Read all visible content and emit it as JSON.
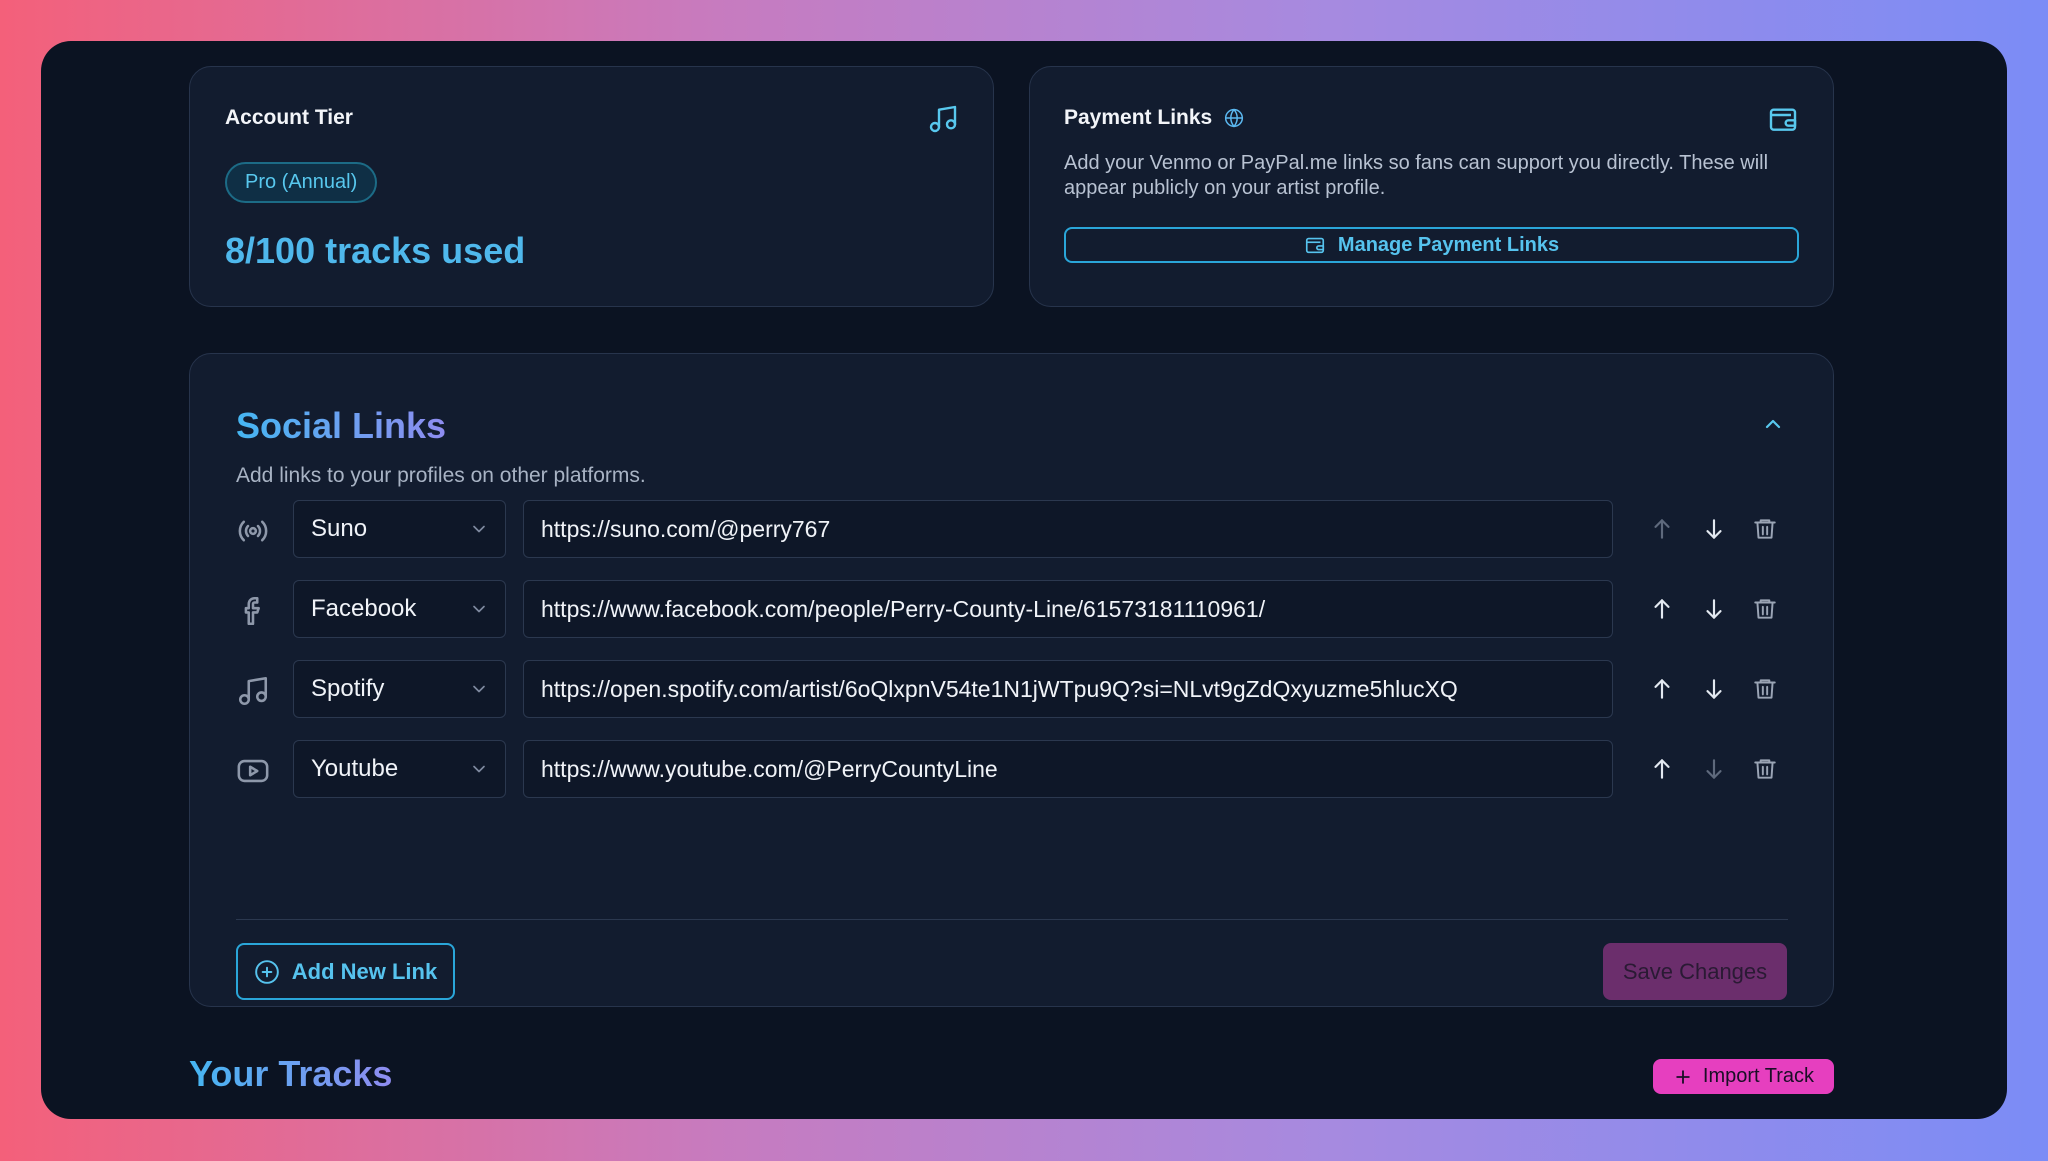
{
  "account_tier": {
    "title": "Account Tier",
    "badge": "Pro (Annual)",
    "usage": "8/100 tracks used",
    "icon": "music-note-icon"
  },
  "payment_links": {
    "title": "Payment Links",
    "info_icon": "globe-icon",
    "card_icon": "wallet-icon",
    "description": "Add your Venmo or PayPal.me links so fans can support you directly. These will appear publicly on your artist profile.",
    "button_label": "Manage Payment Links"
  },
  "social_links": {
    "title": "Social Links",
    "description": "Add links to your profiles on other platforms.",
    "rows": [
      {
        "icon": "broadcast-icon",
        "platform": "Suno",
        "url": "https://suno.com/@perry767",
        "up_enabled": false,
        "down_enabled": true
      },
      {
        "icon": "facebook-icon",
        "platform": "Facebook",
        "url": "https://www.facebook.com/people/Perry-County-Line/61573181110961/",
        "up_enabled": true,
        "down_enabled": true
      },
      {
        "icon": "music-note-icon",
        "platform": "Spotify",
        "url": "https://open.spotify.com/artist/6oQlxpnV54te1N1jWTpu9Q?si=NLvt9gZdQxyuzme5hlucXQ",
        "up_enabled": true,
        "down_enabled": true
      },
      {
        "icon": "youtube-icon",
        "platform": "Youtube",
        "url": "https://www.youtube.com/@PerryCountyLine",
        "up_enabled": true,
        "down_enabled": false
      }
    ],
    "add_label": "Add New Link",
    "save_label": "Save Changes"
  },
  "tracks": {
    "title": "Your Tracks",
    "import_label": "Import Track"
  },
  "colors": {
    "accent": "#2aa6d9",
    "background": "#0b1322",
    "card": "#121c2f",
    "import": "#e63fbf"
  }
}
